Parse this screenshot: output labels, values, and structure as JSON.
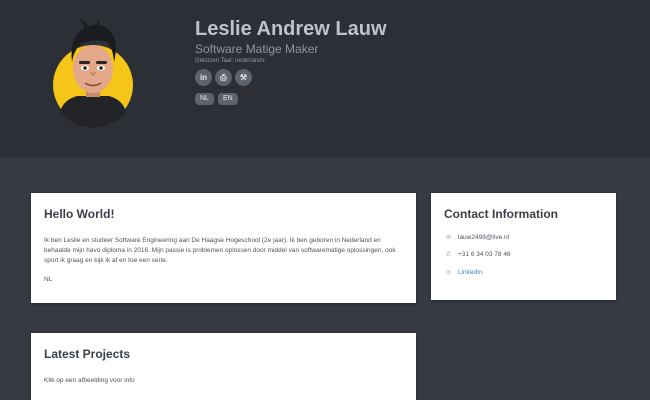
{
  "profile": {
    "name": "Leslie Andrew Lauw",
    "role": "Software Matige Maker",
    "language_note": "Gekozen Taal: nederlands",
    "socials": [
      {
        "icon": "linkedin-icon",
        "glyph": "in"
      },
      {
        "icon": "printer-icon",
        "glyph": "⎙"
      },
      {
        "icon": "tool-icon",
        "glyph": "⚒"
      }
    ],
    "languages": [
      "NL",
      "EN"
    ]
  },
  "hello": {
    "title": "Hello World!",
    "paragraph": "Ik ben Leslie en studeer Software Engineering aan De Haagse Hogeschool (2e jaar). Ik ben geboren in Nederland en behaalde mijn havo diploma in 2016. Mijn passie is problemen oplossen door middel van softwarematige oplossingen, ook sport ik graag en kijk ik af en toe een serie.",
    "lang_code": "NL"
  },
  "contact": {
    "title": "Contact Information",
    "email": "lauw2498@live.nl",
    "phone": "+31 6 34 03 78 46",
    "linkedin": "LinkedIn"
  },
  "projects": {
    "title": "Latest Projects",
    "subtitle": "Klik op een afbeelding voor info"
  },
  "colors": {
    "header_bg": "#2c2f35",
    "page_bg": "#363a42",
    "avatar_ring": "#f5c518",
    "link": "#3a86c8"
  }
}
